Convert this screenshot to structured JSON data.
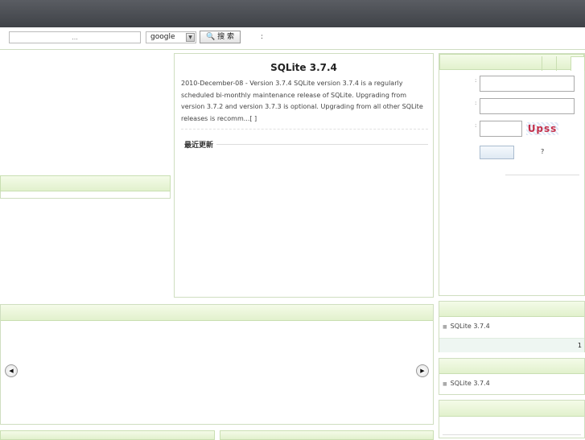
{
  "search": {
    "placeholder": "...",
    "engine": "google",
    "button_label": "🔍 搜 索",
    "trailing_colon": ":"
  },
  "article": {
    "title": "SQLite 3.7.4",
    "summary": "2010-December-08 - Version 3.7.4 SQLite version 3.7.4 is a regularly scheduled bi-monthly maintenance release of SQLite. Upgrading from version 3.7.2 and version 3.7.3 is optional. Upgrading from all other SQLite releases is recomm...[  ]"
  },
  "recent": {
    "label": "最近更新"
  },
  "login": {
    "label_colon": ":",
    "captcha_text": "Upss",
    "forgot": "?"
  },
  "slider": {
    "prev_icon": "chevron-left-icon",
    "next_icon": "chevron-right-icon",
    "prev_glyph": "◀",
    "next_glyph": "▶"
  },
  "list1": {
    "items": [
      "SQLite 3.7.4"
    ],
    "page": "1"
  },
  "list2": {
    "items": [
      "SQLite 3.7.4"
    ]
  },
  "colors": {
    "topbar": "#4a4d52",
    "accent_green": "#e2f1cd",
    "border_green": "#c9dfb2"
  }
}
